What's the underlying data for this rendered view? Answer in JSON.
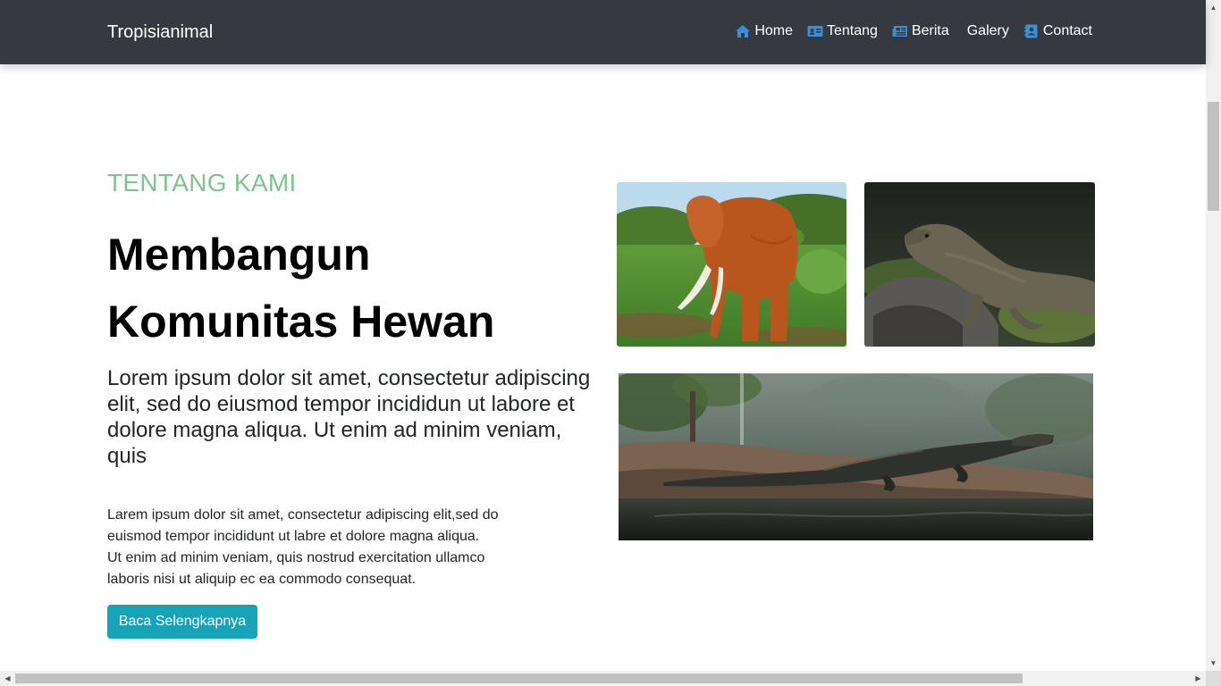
{
  "navbar": {
    "brand": "Tropisianimal",
    "items": [
      {
        "label": "Home",
        "icon": "home-icon"
      },
      {
        "label": "Tentang",
        "icon": "id-card-icon"
      },
      {
        "label": "Berita",
        "icon": "newspaper-icon"
      },
      {
        "label": "Galery",
        "icon": ""
      },
      {
        "label": "Contact",
        "icon": "address-book-icon"
      }
    ],
    "icon_color": "#3b8fd8",
    "background": "#343a40"
  },
  "about": {
    "eyebrow": "TENTANG KAMI",
    "headline": "Membangun Komunitas Hewan",
    "lead": "Lorem ipsum dolor sit amet, consectetur adipiscing elit, sed do eiusmod tempor incididun ut labore et dolore magna aliqua. Ut enim ad minim veniam, quis",
    "body_lines": [
      "Larem ipsum dolor sit amet, consectetur adipiscing elit,sed do",
      "euismod tempor incididunt ut labre et dolore magna aliqua.",
      "Ut enim ad minim veniam, quis nostrud exercitation ullamco",
      "laboris nisi ut aliquip ec ea commodo consequat."
    ],
    "button_label": "Baca Selengkapnya",
    "eyebrow_color": "#7dc48f",
    "button_color": "#17a2b8"
  },
  "gallery": {
    "images": [
      "elephant-photo",
      "komodo-dragon-photo",
      "crocodile-photo"
    ]
  }
}
